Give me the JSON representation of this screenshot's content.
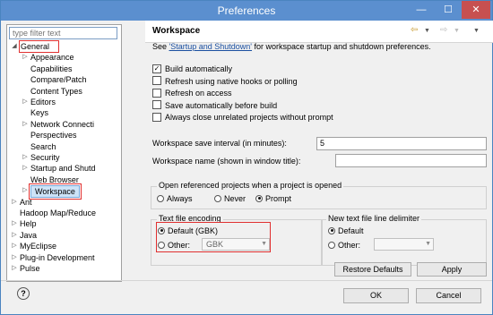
{
  "window": {
    "title": "Preferences"
  },
  "filter": {
    "placeholder": "type filter text"
  },
  "tree": [
    {
      "label": "General",
      "indent": 0,
      "arrow": "◢"
    },
    {
      "label": "Appearance",
      "indent": 1,
      "arrow": "▷"
    },
    {
      "label": "Capabilities",
      "indent": 1,
      "arrow": ""
    },
    {
      "label": "Compare/Patch",
      "indent": 1,
      "arrow": ""
    },
    {
      "label": "Content Types",
      "indent": 1,
      "arrow": ""
    },
    {
      "label": "Editors",
      "indent": 1,
      "arrow": "▷"
    },
    {
      "label": "Keys",
      "indent": 1,
      "arrow": ""
    },
    {
      "label": "Network Connecti",
      "indent": 1,
      "arrow": "▷"
    },
    {
      "label": "Perspectives",
      "indent": 1,
      "arrow": ""
    },
    {
      "label": "Search",
      "indent": 1,
      "arrow": ""
    },
    {
      "label": "Security",
      "indent": 1,
      "arrow": "▷"
    },
    {
      "label": "Startup and Shutd",
      "indent": 1,
      "arrow": "▷"
    },
    {
      "label": "Web Browser",
      "indent": 1,
      "arrow": ""
    },
    {
      "label": "Workspace",
      "indent": 1,
      "arrow": "▷"
    },
    {
      "label": "Ant",
      "indent": 0,
      "arrow": "▷"
    },
    {
      "label": "Hadoop Map/Reduce",
      "indent": 0,
      "arrow": ""
    },
    {
      "label": "Help",
      "indent": 0,
      "arrow": "▷"
    },
    {
      "label": "Java",
      "indent": 0,
      "arrow": "▷"
    },
    {
      "label": "MyEclipse",
      "indent": 0,
      "arrow": "▷"
    },
    {
      "label": "Plug-in Development",
      "indent": 0,
      "arrow": "▷"
    },
    {
      "label": "Pulse",
      "indent": 0,
      "arrow": "▷"
    }
  ],
  "page": {
    "title": "Workspace",
    "see_prefix": "See ",
    "see_link": "'Startup and Shutdown'",
    "see_suffix": " for workspace startup and shutdown preferences.",
    "options": [
      {
        "label": "Build automatically",
        "checked": true
      },
      {
        "label": "Refresh using native hooks or polling",
        "checked": false
      },
      {
        "label": "Refresh on access",
        "checked": false
      },
      {
        "label": "Save automatically before build",
        "checked": false
      },
      {
        "label": "Always close unrelated projects without prompt",
        "checked": false
      }
    ],
    "save_interval_label": "Workspace save interval (in minutes):",
    "save_interval_value": "5",
    "name_label": "Workspace name (shown in window title):",
    "name_value": "",
    "open_ref": {
      "title": "Open referenced projects when a project is opened",
      "options": [
        "Always",
        "Never",
        "Prompt"
      ],
      "selected": "Prompt"
    },
    "encoding": {
      "title": "Text file encoding",
      "default_label": "Default (GBK)",
      "other_label": "Other:",
      "other_value": "GBK",
      "selected": "default"
    },
    "delimiter": {
      "title": "New text file line delimiter",
      "default_label": "Default",
      "other_label": "Other:",
      "selected": "default"
    },
    "restore_label": "Restore Defaults",
    "apply_label": "Apply"
  },
  "footer": {
    "help": "?",
    "ok_label": "OK",
    "cancel_label": "Cancel"
  },
  "colors": {
    "selection_outline": "#e03030",
    "title_bar": "#5b8fcf",
    "link": "#1a4fa0"
  }
}
